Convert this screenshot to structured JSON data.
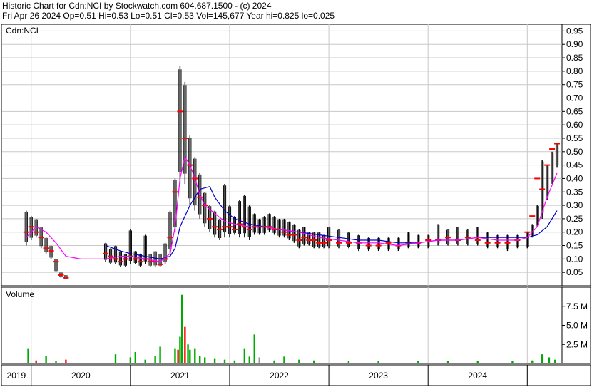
{
  "header": {
    "line1": "Historic Chart for Cdn:NCI by Stockwatch.com 604.687.1500 - (c) 2024",
    "line2": "Fri Apr 26 2024  Op=0.51  Hi=0.53  Lo=0.51  Cl=0.53  Vol=145,677  Year hi=0.825  lo=0.025"
  },
  "colors": {
    "price_bar": "#000000",
    "close_tick_red": "#ff0000",
    "ma_short": "#ff00ff",
    "ma_long": "#0000cc",
    "volume_up": "#00aa00",
    "volume_down": "#ff0000",
    "volume_neutral": "#999999",
    "grid": "#c8c8c8"
  },
  "chart_data": [
    {
      "type": "line",
      "title": "Cdn:NCI",
      "symbol": "Cdn:NCI",
      "y_ticks": [
        "0.95",
        "0.90",
        "0.85",
        "0.80",
        "0.75",
        "0.70",
        "0.65",
        "0.60",
        "0.55",
        "0.50",
        "0.45",
        "0.40",
        "0.35",
        "0.30",
        "0.25",
        "0.20",
        "0.15",
        "0.10",
        "0.05"
      ],
      "ylim": [
        0,
        0.975
      ],
      "x_labels": [
        "2019",
        "2020",
        "2021",
        "2022",
        "2023",
        "2024"
      ],
      "grid": true,
      "series": [
        {
          "role": "price_high_low",
          "x": [
            2018.95,
            2019.0,
            2019.05,
            2019.1,
            2019.15,
            2019.2,
            2019.25,
            2019.3,
            2019.35,
            2019.4,
            2019.45,
            2019.5,
            2019.55,
            2019.6,
            2019.65,
            2019.7,
            2019.75,
            2019.8,
            2019.85,
            2019.9,
            2019.95,
            2020.0,
            2020.05,
            2020.1,
            2020.15,
            2020.2,
            2020.25,
            2020.3,
            2020.35,
            2020.4,
            2020.45,
            2020.5,
            2020.55,
            2020.6,
            2020.65,
            2020.7,
            2020.75,
            2020.8,
            2020.85,
            2020.9,
            2020.95,
            2021.0,
            2021.05,
            2021.1,
            2021.15,
            2021.2,
            2021.25,
            2021.3,
            2021.35,
            2021.4,
            2021.45,
            2021.5,
            2021.55,
            2021.6,
            2021.65,
            2021.7,
            2021.75,
            2021.8,
            2021.85,
            2021.9,
            2021.95,
            2022.0,
            2022.1,
            2022.2,
            2022.3,
            2022.4,
            2022.5,
            2022.6,
            2022.7,
            2022.8,
            2022.9,
            2023.0,
            2023.1,
            2023.2,
            2023.3,
            2023.4,
            2023.5,
            2023.6,
            2023.7,
            2023.8,
            2023.9,
            2024.0,
            2024.05,
            2024.1,
            2024.15,
            2024.2,
            2024.25,
            2024.3
          ],
          "high": [
            0.28,
            0.26,
            0.25,
            0.22,
            0.18,
            0.15,
            0.1,
            0.05,
            0.04,
            null,
            null,
            null,
            null,
            null,
            null,
            null,
            0.16,
            0.14,
            0.15,
            0.13,
            0.12,
            0.21,
            0.13,
            0.12,
            0.19,
            0.12,
            0.13,
            0.12,
            0.16,
            0.28,
            0.4,
            0.82,
            0.76,
            0.56,
            0.48,
            0.42,
            0.35,
            0.3,
            0.28,
            0.25,
            0.38,
            0.3,
            0.26,
            0.32,
            0.34,
            0.3,
            0.27,
            0.25,
            0.26,
            0.27,
            0.26,
            0.25,
            0.25,
            0.24,
            0.23,
            0.21,
            0.22,
            0.2,
            0.2,
            0.2,
            0.19,
            0.22,
            0.21,
            0.2,
            0.19,
            0.18,
            0.18,
            0.18,
            0.18,
            0.2,
            0.19,
            0.19,
            0.23,
            0.21,
            0.22,
            0.21,
            0.22,
            0.2,
            0.19,
            0.19,
            0.19,
            0.2,
            0.23,
            0.3,
            0.47,
            0.45,
            0.5,
            0.53
          ],
          "low": [
            0.15,
            0.17,
            0.18,
            0.14,
            0.12,
            0.1,
            0.05,
            0.03,
            0.025,
            null,
            null,
            null,
            null,
            null,
            null,
            null,
            0.09,
            0.08,
            0.08,
            0.07,
            0.07,
            0.08,
            0.08,
            0.07,
            0.08,
            0.07,
            0.07,
            0.07,
            0.08,
            0.12,
            0.2,
            0.38,
            0.38,
            0.3,
            0.28,
            0.25,
            0.22,
            0.2,
            0.18,
            0.17,
            0.18,
            0.18,
            0.19,
            0.18,
            0.18,
            0.17,
            0.19,
            0.19,
            0.19,
            0.2,
            0.19,
            0.18,
            0.18,
            0.17,
            0.16,
            0.14,
            0.15,
            0.15,
            0.14,
            0.14,
            0.14,
            0.14,
            0.14,
            0.14,
            0.13,
            0.13,
            0.13,
            0.13,
            0.13,
            0.14,
            0.14,
            0.14,
            0.15,
            0.15,
            0.15,
            0.15,
            0.15,
            0.14,
            0.14,
            0.13,
            0.14,
            0.14,
            0.18,
            0.22,
            0.25,
            0.32,
            0.38,
            0.44
          ]
        },
        {
          "role": "close",
          "x": [
            2018.95,
            2019.0,
            2019.05,
            2019.1,
            2019.15,
            2019.2,
            2019.25,
            2019.3,
            2019.35,
            2019.75,
            2019.8,
            2019.85,
            2019.9,
            2019.95,
            2020.0,
            2020.05,
            2020.1,
            2020.15,
            2020.2,
            2020.25,
            2020.3,
            2020.35,
            2020.4,
            2020.45,
            2020.5,
            2020.55,
            2020.6,
            2020.65,
            2020.7,
            2020.75,
            2020.8,
            2020.85,
            2020.9,
            2020.95,
            2021.0,
            2021.05,
            2021.1,
            2021.15,
            2021.2,
            2021.25,
            2021.3,
            2021.35,
            2021.4,
            2021.45,
            2021.5,
            2021.55,
            2021.6,
            2021.65,
            2021.7,
            2021.75,
            2021.8,
            2021.85,
            2021.9,
            2021.95,
            2022.0,
            2022.1,
            2022.2,
            2022.3,
            2022.4,
            2022.5,
            2022.6,
            2022.7,
            2022.8,
            2022.9,
            2023.0,
            2023.1,
            2023.2,
            2023.3,
            2023.4,
            2023.5,
            2023.6,
            2023.7,
            2023.8,
            2023.9,
            2024.0,
            2024.05,
            2024.1,
            2024.15,
            2024.2,
            2024.25,
            2024.3
          ],
          "values": [
            0.2,
            0.22,
            0.2,
            0.18,
            0.14,
            0.13,
            0.09,
            0.04,
            0.03,
            0.12,
            0.11,
            0.1,
            0.09,
            0.1,
            0.11,
            0.1,
            0.09,
            0.1,
            0.09,
            0.09,
            0.08,
            0.1,
            0.18,
            0.35,
            0.65,
            0.55,
            0.45,
            0.4,
            0.33,
            0.3,
            0.25,
            0.22,
            0.21,
            0.22,
            0.22,
            0.21,
            0.23,
            0.22,
            0.21,
            0.22,
            0.22,
            0.22,
            0.22,
            0.21,
            0.21,
            0.2,
            0.19,
            0.19,
            0.17,
            0.18,
            0.17,
            0.17,
            0.16,
            0.16,
            0.17,
            0.16,
            0.16,
            0.16,
            0.15,
            0.15,
            0.16,
            0.15,
            0.16,
            0.16,
            0.17,
            0.17,
            0.18,
            0.17,
            0.18,
            0.17,
            0.16,
            0.16,
            0.16,
            0.17,
            0.2,
            0.26,
            0.4,
            0.36,
            0.45,
            0.51,
            0.53
          ]
        },
        {
          "role": "moving_average_short",
          "x": [
            2018.95,
            2019.05,
            2019.15,
            2019.25,
            2019.35,
            2019.5,
            2019.75,
            2019.9,
            2020.0,
            2020.15,
            2020.3,
            2020.4,
            2020.45,
            2020.5,
            2020.55,
            2020.6,
            2020.65,
            2020.7,
            2020.75,
            2020.85,
            2020.95,
            2021.05,
            2021.2,
            2021.35,
            2021.5,
            2021.7,
            2021.9,
            2022.1,
            2022.3,
            2022.5,
            2022.7,
            2022.9,
            2023.1,
            2023.3,
            2023.5,
            2023.7,
            2023.9,
            2024.0,
            2024.1,
            2024.2,
            2024.3
          ],
          "values": [
            0.18,
            0.22,
            0.2,
            0.16,
            0.11,
            0.1,
            0.1,
            0.11,
            0.11,
            0.1,
            0.09,
            0.12,
            0.22,
            0.4,
            0.48,
            0.45,
            0.4,
            0.34,
            0.3,
            0.27,
            0.24,
            0.23,
            0.22,
            0.22,
            0.21,
            0.2,
            0.18,
            0.17,
            0.16,
            0.16,
            0.15,
            0.16,
            0.17,
            0.17,
            0.18,
            0.17,
            0.17,
            0.18,
            0.22,
            0.33,
            0.42
          ]
        },
        {
          "role": "moving_average_long",
          "x": [
            2019.75,
            2019.9,
            2020.0,
            2020.15,
            2020.3,
            2020.4,
            2020.45,
            2020.5,
            2020.6,
            2020.7,
            2020.8,
            2020.85,
            2020.95,
            2021.05,
            2021.2,
            2021.35,
            2021.5,
            2021.7,
            2021.9,
            2022.1,
            2022.3,
            2022.5,
            2022.7,
            2022.9,
            2023.1,
            2023.3,
            2023.5,
            2023.7,
            2023.9,
            2024.0,
            2024.1,
            2024.2,
            2024.3
          ],
          "values": [
            0.15,
            0.13,
            0.12,
            0.11,
            0.1,
            0.11,
            0.14,
            0.22,
            0.3,
            0.36,
            0.37,
            0.33,
            0.28,
            0.25,
            0.23,
            0.22,
            0.21,
            0.2,
            0.19,
            0.18,
            0.17,
            0.17,
            0.16,
            0.16,
            0.17,
            0.17,
            0.18,
            0.18,
            0.18,
            0.18,
            0.19,
            0.22,
            0.28
          ]
        }
      ]
    },
    {
      "type": "bar",
      "title": "Volume",
      "y_ticks": [
        "7.5 M",
        "5.0 M",
        "2.5 M"
      ],
      "ylim": [
        0,
        10
      ],
      "x": [
        2018.97,
        2019.05,
        2019.15,
        2019.25,
        2019.35,
        2019.85,
        2020.0,
        2020.05,
        2020.15,
        2020.25,
        2020.3,
        2020.45,
        2020.48,
        2020.5,
        2020.52,
        2020.55,
        2020.58,
        2020.6,
        2020.65,
        2020.7,
        2020.75,
        2020.85,
        2020.95,
        2021.05,
        2021.15,
        2021.2,
        2021.25,
        2021.3,
        2021.45,
        2021.55,
        2021.7,
        2021.85,
        2022.2,
        2022.5,
        2022.9,
        2023.2,
        2023.5,
        2023.85,
        2024.05,
        2024.15,
        2024.22,
        2024.28
      ],
      "values": [
        2.0,
        0.4,
        1.0,
        0.3,
        0.5,
        1.2,
        0.8,
        1.5,
        0.5,
        1.0,
        2.2,
        2.0,
        1.8,
        3.5,
        9.0,
        4.8,
        2.5,
        1.8,
        2.0,
        1.0,
        0.8,
        0.6,
        0.5,
        0.4,
        2.0,
        0.9,
        3.8,
        0.8,
        0.4,
        0.9,
        0.5,
        0.4,
        0.3,
        0.3,
        0.3,
        0.3,
        0.3,
        0.3,
        0.4,
        1.2,
        0.8,
        0.5
      ],
      "direction": [
        "up",
        "down",
        "up",
        "up",
        "down",
        "up",
        "up",
        "up",
        "up",
        "up",
        "up",
        "up",
        "down",
        "up",
        "up",
        "down",
        "up",
        "up",
        "up",
        "up",
        "up",
        "up",
        "up",
        "up",
        "up",
        "up",
        "up",
        "neutral",
        "up",
        "up",
        "up",
        "up",
        "up",
        "up",
        "up",
        "up",
        "up",
        "up",
        "up",
        "up",
        "up",
        "up"
      ]
    }
  ]
}
